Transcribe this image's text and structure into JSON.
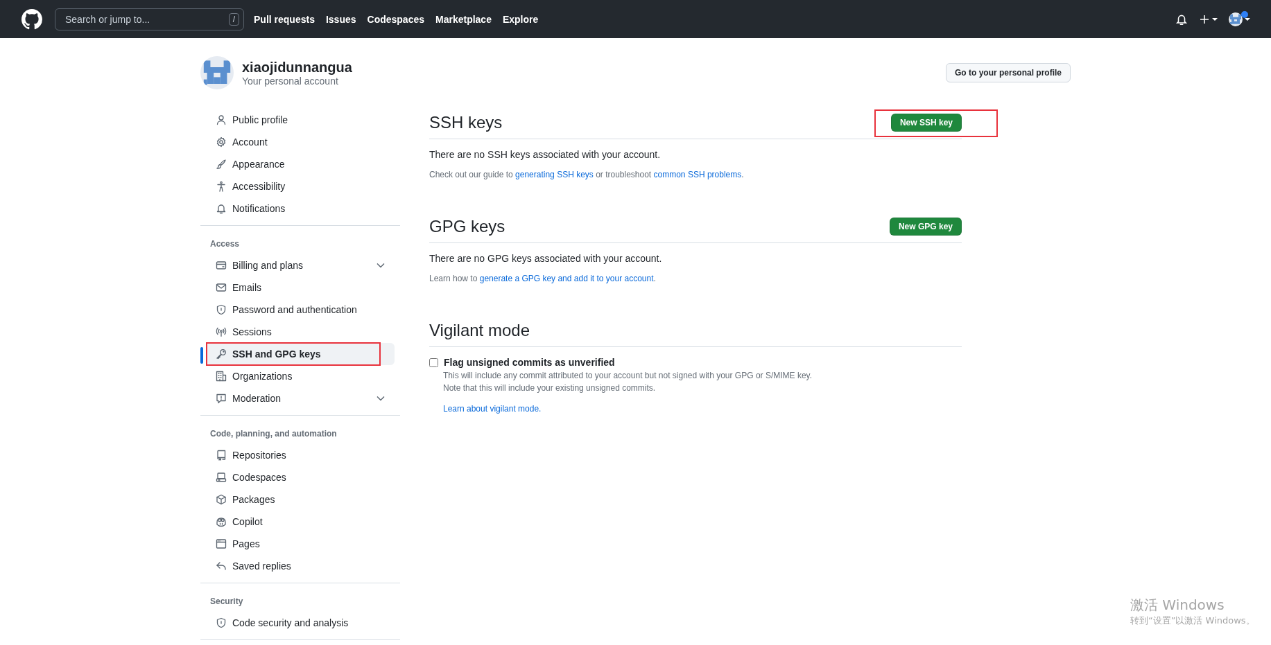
{
  "header": {
    "search": {
      "placeholder": "Search or jump to...",
      "shortcut": "/"
    },
    "nav": [
      "Pull requests",
      "Issues",
      "Codespaces",
      "Marketplace",
      "Explore"
    ],
    "unread": true
  },
  "account": {
    "name": "xiaojidunnangua",
    "subtitle": "Your personal account",
    "profile_button": "Go to your personal profile"
  },
  "sidebar": {
    "sections": [
      {
        "items": [
          {
            "label": "Public profile",
            "selected": false,
            "expandable": false,
            "annotated": false
          },
          {
            "label": "Account",
            "selected": false,
            "expandable": false,
            "annotated": false
          },
          {
            "label": "Appearance",
            "selected": false,
            "expandable": false,
            "annotated": false
          },
          {
            "label": "Accessibility",
            "selected": false,
            "expandable": false,
            "annotated": false
          },
          {
            "label": "Notifications",
            "selected": false,
            "expandable": false,
            "annotated": false
          }
        ]
      },
      {
        "heading": "Access",
        "items": [
          {
            "label": "Billing and plans",
            "selected": false,
            "expandable": true,
            "annotated": false
          },
          {
            "label": "Emails",
            "selected": false,
            "expandable": false,
            "annotated": false
          },
          {
            "label": "Password and authentication",
            "selected": false,
            "expandable": false,
            "annotated": false
          },
          {
            "label": "Sessions",
            "selected": false,
            "expandable": false,
            "annotated": false
          },
          {
            "label": "SSH and GPG keys",
            "selected": true,
            "expandable": false,
            "annotated": true
          },
          {
            "label": "Organizations",
            "selected": false,
            "expandable": false,
            "annotated": false
          },
          {
            "label": "Moderation",
            "selected": false,
            "expandable": true,
            "annotated": false
          }
        ]
      },
      {
        "heading": "Code, planning, and automation",
        "items": [
          {
            "label": "Repositories",
            "selected": false,
            "expandable": false,
            "annotated": false
          },
          {
            "label": "Codespaces",
            "selected": false,
            "expandable": false,
            "annotated": false
          },
          {
            "label": "Packages",
            "selected": false,
            "expandable": false,
            "annotated": false
          },
          {
            "label": "Copilot",
            "selected": false,
            "expandable": false,
            "annotated": false
          },
          {
            "label": "Pages",
            "selected": false,
            "expandable": false,
            "annotated": false
          },
          {
            "label": "Saved replies",
            "selected": false,
            "expandable": false,
            "annotated": false
          }
        ]
      },
      {
        "heading": "Security",
        "items": [
          {
            "label": "Code security and analysis",
            "selected": false,
            "expandable": false,
            "annotated": false
          }
        ]
      }
    ]
  },
  "main": {
    "sections": [
      {
        "kind": "keys",
        "title": "SSH keys",
        "button": {
          "label": "New SSH key",
          "annotated": true
        },
        "empty_text": "There are no SSH keys associated with your account.",
        "help": [
          {
            "text": "Check out our guide to "
          },
          {
            "link": "generating SSH keys"
          },
          {
            "text": " or troubleshoot "
          },
          {
            "link": "common SSH problems"
          },
          {
            "text": "."
          }
        ]
      },
      {
        "kind": "keys",
        "title": "GPG keys",
        "button": {
          "label": "New GPG key",
          "annotated": false
        },
        "empty_text": "There are no GPG keys associated with your account.",
        "help": [
          {
            "text": "Learn how to "
          },
          {
            "link": "generate a GPG key and add it to your account"
          },
          {
            "text": "."
          }
        ]
      },
      {
        "kind": "setting",
        "title": "Vigilant mode",
        "checkbox": {
          "label": "Flag unsigned commits as unverified",
          "checked": false
        },
        "notes": [
          "This will include any commit attributed to your account but not signed with your GPG or S/MIME key.",
          "Note that this will include your existing unsigned commits."
        ],
        "link": "Learn about vigilant mode."
      }
    ]
  },
  "activation_notice": {
    "title": "激活 Windows",
    "subtitle": "转到“设置”以激活 Windows。"
  }
}
